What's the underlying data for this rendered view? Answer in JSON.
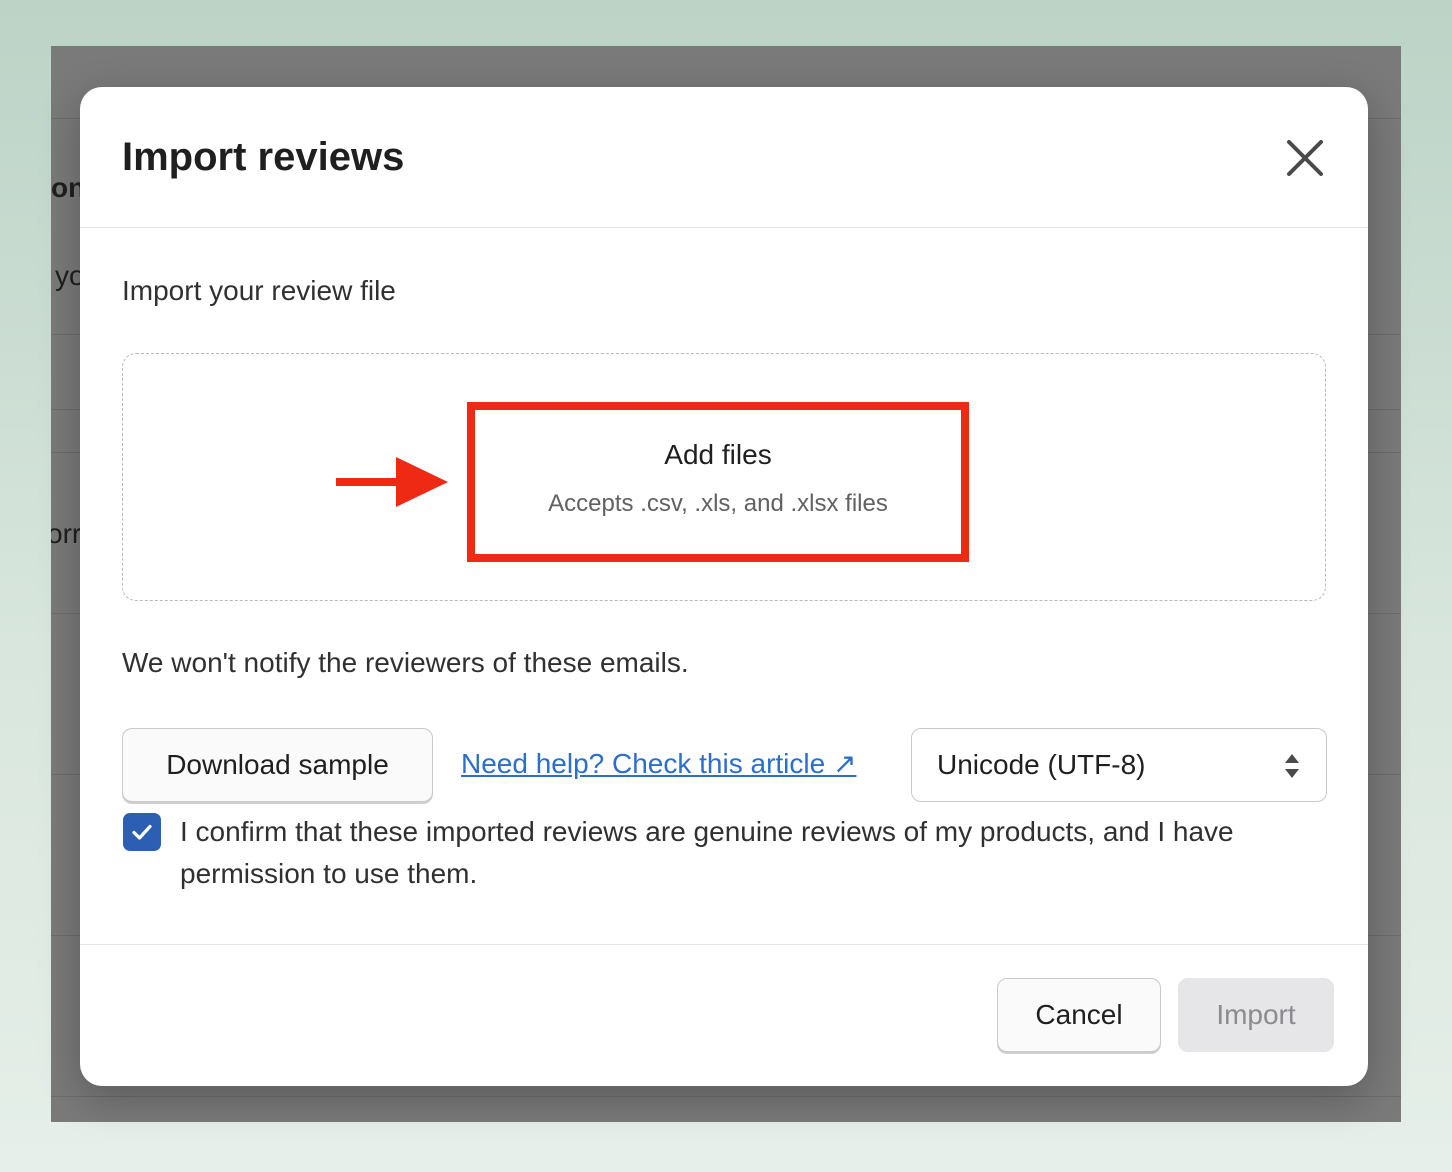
{
  "background_page": {
    "fragments": [
      "on",
      "yo",
      "orr"
    ]
  },
  "modal": {
    "title": "Import reviews",
    "close_icon": "close-icon",
    "section_label": "Import your review file",
    "dropzone": {
      "button_label": "Add files",
      "hint": "Accepts .csv, .xls, and .xlsx files"
    },
    "notice": "We won't notify the reviewers of these emails.",
    "download_label": "Download sample",
    "help_link": "Need help? Check this article ↗",
    "encoding": {
      "selected": "Unicode (UTF-8)"
    },
    "confirm": {
      "checked": true,
      "label": "I confirm that these imported reviews are genuine reviews of my products, and I have permission to use them."
    },
    "footer": {
      "cancel_label": "Cancel",
      "import_label": "Import"
    }
  },
  "annotation": {
    "highlight_color": "#ee2a15",
    "arrow_icon": "arrow-right-icon"
  },
  "colors": {
    "link": "#2c6ecb",
    "checkbox": "#2c5fb3",
    "overlay": "#7a7a7a"
  }
}
